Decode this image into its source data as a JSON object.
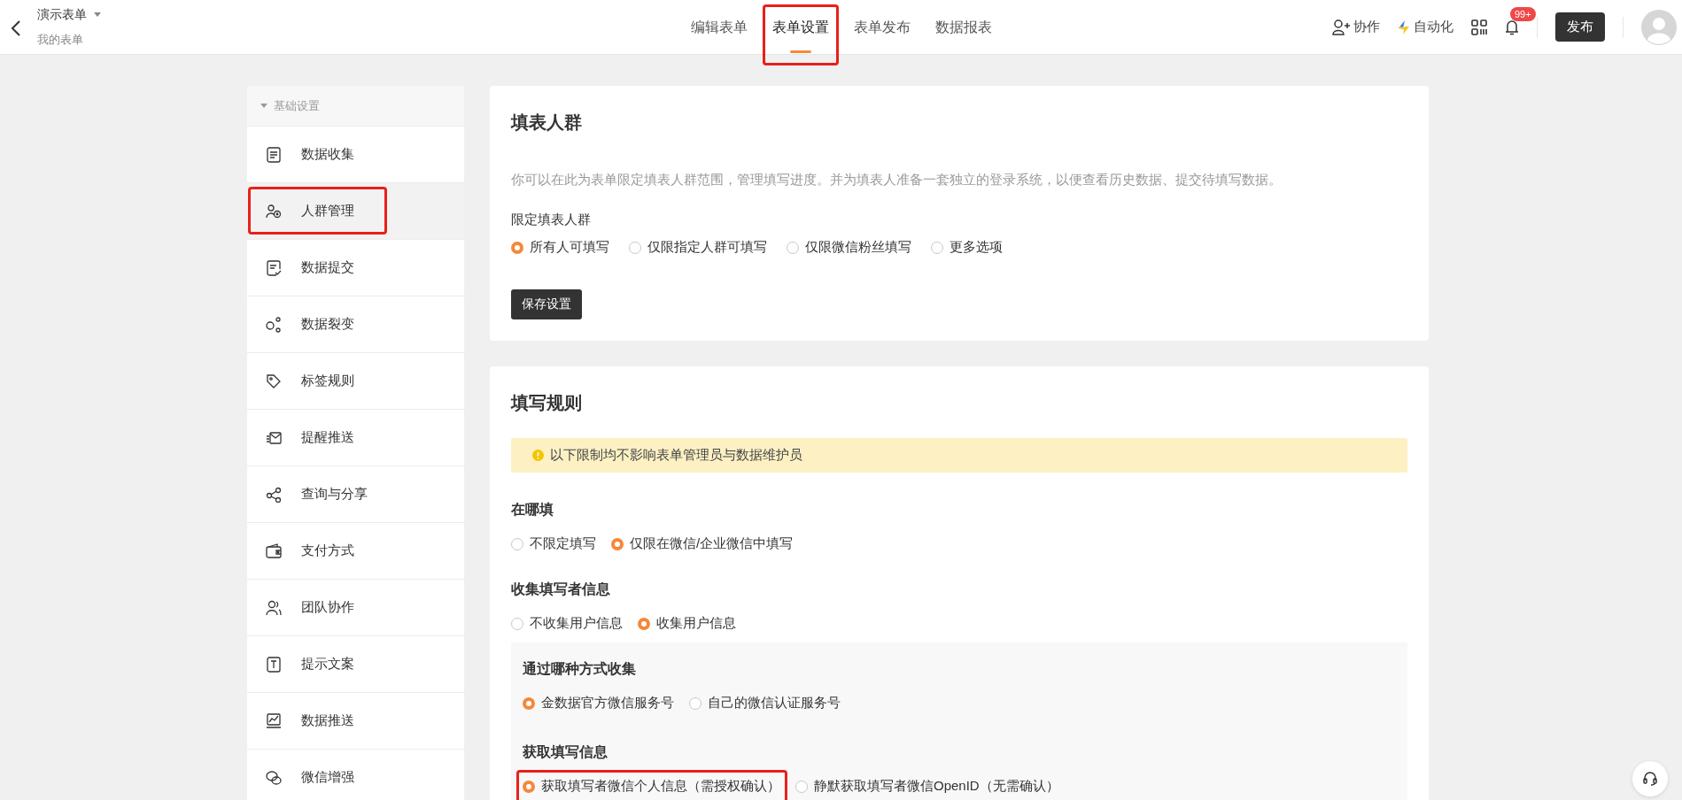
{
  "header": {
    "title": "演示表单",
    "subtitle": "我的表单"
  },
  "nav_tabs": [
    {
      "label": "编辑表单",
      "selected": false
    },
    {
      "label": "表单设置",
      "selected": true,
      "highlighted": true
    },
    {
      "label": "表单发布",
      "selected": false
    },
    {
      "label": "数据报表",
      "selected": false
    }
  ],
  "toolbar": {
    "collaborate": "协作",
    "automation": "自动化",
    "notification_badge": "99+",
    "publish": "发布"
  },
  "sidebar": {
    "group": "基础设置",
    "expanded": true,
    "items": [
      {
        "label": "数据收集",
        "selected": false
      },
      {
        "label": "人群管理",
        "selected": true,
        "highlighted": true
      },
      {
        "label": "数据提交",
        "selected": false
      },
      {
        "label": "数据裂变",
        "selected": false
      },
      {
        "label": "标签规则",
        "selected": false
      },
      {
        "label": "提醒推送",
        "selected": false
      },
      {
        "label": "查询与分享",
        "selected": false
      },
      {
        "label": "支付方式",
        "selected": false
      },
      {
        "label": "团队协作",
        "selected": false
      },
      {
        "label": "提示文案",
        "selected": false
      },
      {
        "label": "数据推送",
        "selected": false
      },
      {
        "label": "微信增强",
        "selected": false
      }
    ]
  },
  "audience_card": {
    "title": "填表人群",
    "description": "你可以在此为表单限定填表人群范围，管理填写进度。并为填表人准备一套独立的登录系统，以便查看历史数据、提交待填写数据。",
    "field_label": "限定填表人群",
    "options": [
      {
        "label": "所有人可填写",
        "selected": true
      },
      {
        "label": "仅限指定人群可填写",
        "selected": false
      },
      {
        "label": "仅限微信粉丝填写",
        "selected": false
      },
      {
        "label": "更多选项",
        "selected": false
      }
    ],
    "save_button": "保存设置"
  },
  "rules_card": {
    "title": "填写规则",
    "notice": "以下限制均不影响表单管理员与数据维护员",
    "sections": [
      {
        "title": "在哪填",
        "options": [
          {
            "label": "不限定填写",
            "selected": false
          },
          {
            "label": "仅限在微信/企业微信中填写",
            "selected": true
          }
        ]
      },
      {
        "title": "收集填写者信息",
        "options": [
          {
            "label": "不收集用户信息",
            "selected": false
          },
          {
            "label": "收集用户信息",
            "selected": true
          }
        ]
      }
    ],
    "subpanel": [
      {
        "title": "通过哪种方式收集",
        "options": [
          {
            "label": "金数据官方微信服务号",
            "selected": true
          },
          {
            "label": "自己的微信认证服务号",
            "selected": false
          }
        ]
      },
      {
        "title": "获取填写信息",
        "options": [
          {
            "label": "获取填写者微信个人信息（需授权确认）",
            "selected": true,
            "highlighted": true
          },
          {
            "label": "静默获取填写者微信OpenID（无需确认）",
            "selected": false
          }
        ]
      }
    ]
  }
}
